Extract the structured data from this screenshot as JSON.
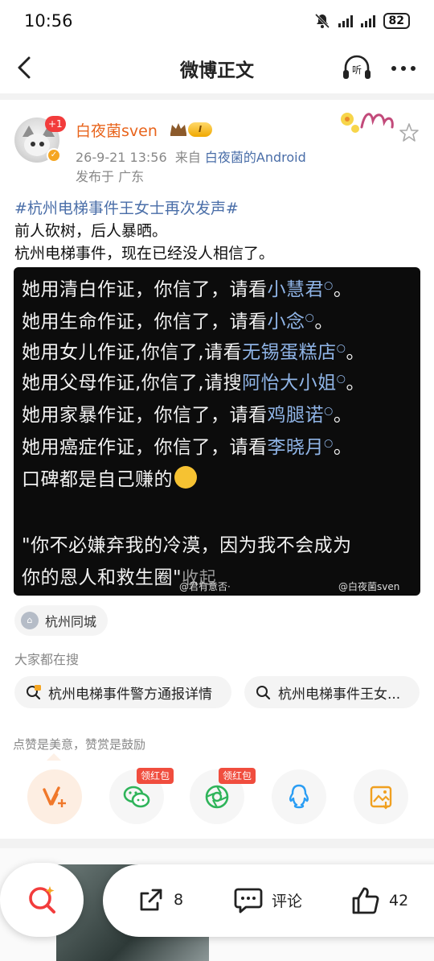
{
  "status_bar": {
    "time": "10:56",
    "battery": "82"
  },
  "nav": {
    "title": "微博正文"
  },
  "post": {
    "notification_badge": "+1",
    "username": "白夜菌sven",
    "vip_level": "I",
    "time": "26-9-21 13:56",
    "from_label": "来自",
    "source": "白夜菌的Android",
    "location": "发布于 广东",
    "hashtag": "#杭州电梯事件王女士再次发声#",
    "lines": [
      "前人砍树，后人暴晒。",
      "杭州电梯事件，现在已经没人相信了。"
    ]
  },
  "image": {
    "rows": [
      {
        "text": "她用清白作证，你信了，请看",
        "keyword": "小慧君",
        "tail": "。"
      },
      {
        "text": "她用生命作证，你信了，请看",
        "keyword": "小念",
        "tail": "。"
      },
      {
        "text": "她用女儿作证,你信了,请看",
        "keyword": "无锡蛋糕店",
        "tail": "。"
      },
      {
        "text": "她用父母作证,你信了,请搜",
        "keyword": "阿怡大小姐",
        "tail": "。"
      },
      {
        "text": "她用家暴作证，你信了，请看",
        "keyword": "鸡腿诺",
        "tail": "。"
      },
      {
        "text": "她用癌症作证，你信了，请看",
        "keyword": "李晓月",
        "tail": "。"
      }
    ],
    "line7": "口碑都是自己赚的",
    "quote1": "\"你不必嫌弃我的冷漠，因为我不会成为",
    "quote2": "你的恩人和救生圈\"",
    "fold": "收起",
    "watermark1": "@君有意否·",
    "watermark2": "@白夜菌sven"
  },
  "location_chip": "杭州同城",
  "search": {
    "title": "大家都在搜",
    "items": [
      "杭州电梯事件警方通报详情",
      "杭州电梯事件王女..."
    ]
  },
  "reward": {
    "title": "点赞是美意，赞赏是鼓励",
    "red_packet_label": "领红包"
  },
  "bottom_bar": {
    "share_count": "8",
    "comment_label": "评论",
    "like_count": "42"
  },
  "colors": {
    "accent": "#e8641c",
    "link": "#4a6ea8",
    "red": "#f04d3e"
  },
  "icons": [
    "back-icon",
    "listen-icon",
    "more-icon",
    "star-icon",
    "location-icon",
    "search-icon",
    "reward-icon",
    "wechat-icon",
    "moments-icon",
    "qq-icon",
    "save-image-icon",
    "share-icon",
    "comment-icon",
    "like-icon"
  ]
}
